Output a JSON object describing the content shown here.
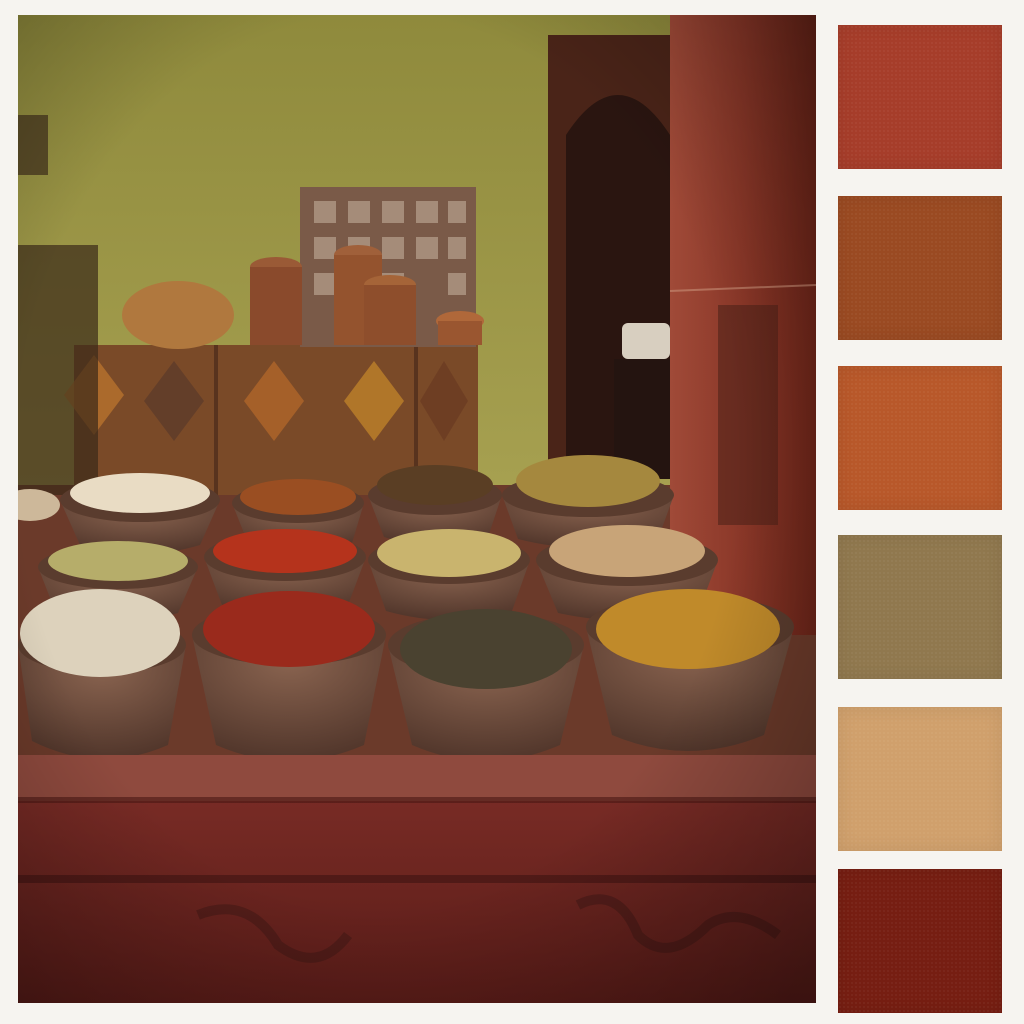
{
  "image": {
    "subject": "spice-market-stall",
    "colors": {
      "wall": "#9a9442",
      "wall_dark": "#6f6a2e",
      "pillar": "#8e3a2a",
      "counter": "#7a2a26",
      "counter_top": "#8f4a3e",
      "bowl": "#6b4a38",
      "doorway": "#2a1510"
    },
    "bowls": [
      {
        "name": "bowl-white-powder",
        "color": "#e9dcc4"
      },
      {
        "name": "bowl-brown-powder",
        "color": "#9a4e22"
      },
      {
        "name": "bowl-mixed-seeds",
        "color": "#5a3e24"
      },
      {
        "name": "bowl-cumin-powder",
        "color": "#a5883e"
      },
      {
        "name": "bowl-green-cardamom",
        "color": "#b6ad6a"
      },
      {
        "name": "bowl-red-chili-powder",
        "color": "#b5331c"
      },
      {
        "name": "bowl-fennel-seeds",
        "color": "#c9b46e"
      },
      {
        "name": "bowl-almonds",
        "color": "#c8a478"
      },
      {
        "name": "bowl-garlic",
        "color": "#ddd2bc"
      },
      {
        "name": "bowl-chili-flakes",
        "color": "#9a2a1c"
      },
      {
        "name": "bowl-dark-herbs",
        "color": "#4a4230"
      },
      {
        "name": "bowl-turmeric-curry",
        "color": "#c08a2a"
      }
    ]
  },
  "palette": {
    "swatches": [
      {
        "name": "swatch-brick-red",
        "color": "#a63d2a"
      },
      {
        "name": "swatch-rust-brown",
        "color": "#9a4a22"
      },
      {
        "name": "swatch-burnt-orange",
        "color": "#b8582a"
      },
      {
        "name": "swatch-olive-khaki",
        "color": "#90784e"
      },
      {
        "name": "swatch-sand-tan",
        "color": "#d0a06c"
      },
      {
        "name": "swatch-oxblood",
        "color": "#761e12"
      }
    ]
  }
}
